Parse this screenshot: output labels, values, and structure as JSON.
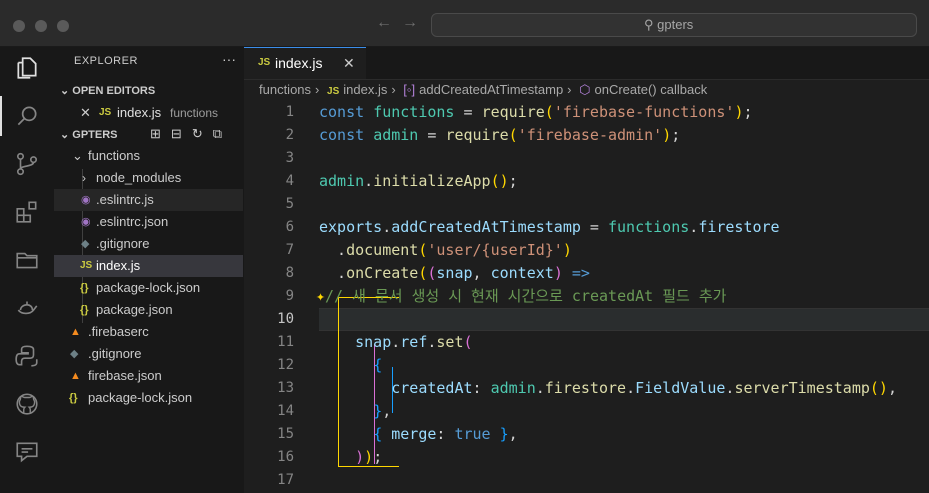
{
  "search": {
    "text": "gpters"
  },
  "sidebar": {
    "title": "EXPLORER",
    "more": "···",
    "open_editors_label": "OPEN EDITORS",
    "open_editor": {
      "name": "index.js",
      "folder": "functions",
      "close": "✕"
    },
    "project_label": "GPTERS",
    "tree": [
      {
        "name": "functions"
      },
      {
        "name": "node_modules"
      },
      {
        "name": ".eslintrc.js"
      },
      {
        "name": ".eslintrc.json"
      },
      {
        "name": ".gitignore"
      },
      {
        "name": "index.js"
      },
      {
        "name": "package-lock.json"
      },
      {
        "name": "package.json"
      },
      {
        "name": ".firebaserc"
      },
      {
        "name": ".gitignore"
      },
      {
        "name": "firebase.json"
      },
      {
        "name": "package-lock.json"
      }
    ]
  },
  "editor": {
    "tab": {
      "label": "index.js",
      "badge": "JS",
      "close": "✕"
    },
    "breadcrumb": {
      "folder": "functions",
      "file": "index.js",
      "symbol": "addCreatedAtTimestamp",
      "callback": "onCreate() callback"
    },
    "line_numbers": [
      "1",
      "2",
      "3",
      "4",
      "5",
      "6",
      "7",
      "8",
      "9",
      "10",
      "11",
      "12",
      "13",
      "14",
      "15",
      "16",
      "17"
    ]
  },
  "colors": {
    "accent": "#3b8eea",
    "js_badge": "#cbcb41",
    "bracket_gold": "#ffd700"
  }
}
